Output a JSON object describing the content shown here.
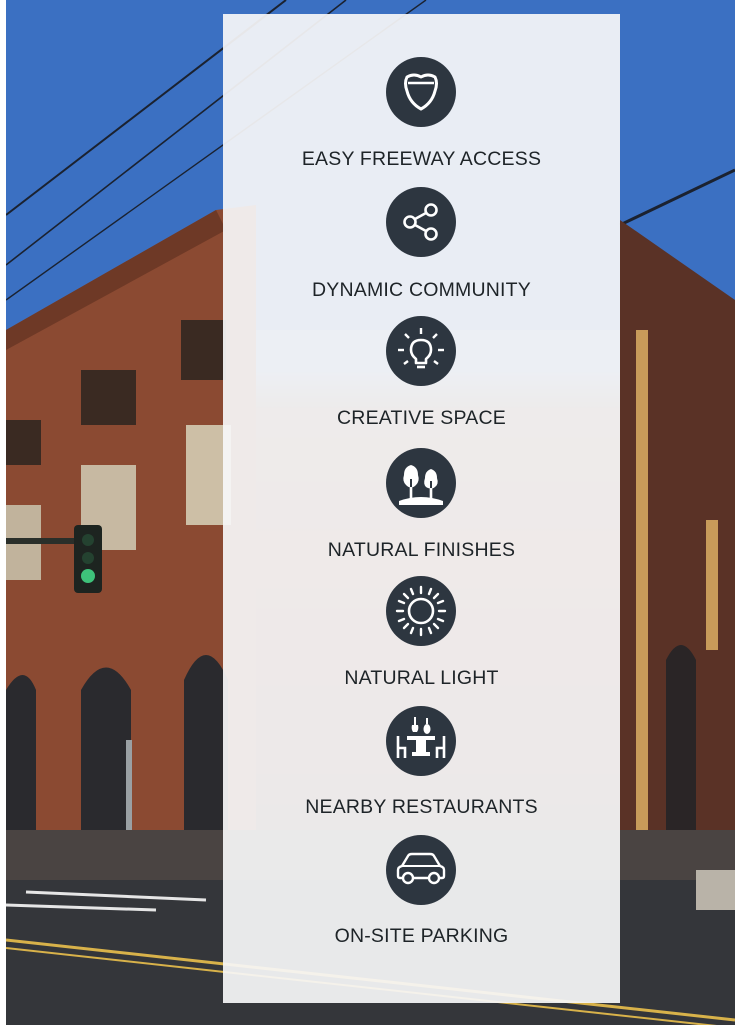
{
  "features": [
    {
      "icon": "highway-shield-icon",
      "label": "EASY FREEWAY ACCESS"
    },
    {
      "icon": "share-network-icon",
      "label": "DYNAMIC COMMUNITY"
    },
    {
      "icon": "lightbulb-icon",
      "label": "CREATIVE SPACE"
    },
    {
      "icon": "trees-icon",
      "label": "NATURAL FINISHES"
    },
    {
      "icon": "sun-icon",
      "label": "NATURAL LIGHT"
    },
    {
      "icon": "dining-table-icon",
      "label": "NEARBY RESTAURANTS"
    },
    {
      "icon": "car-icon",
      "label": "ON-SITE PARKING"
    }
  ],
  "colors": {
    "icon_circle": "#2d3640",
    "panel": "#f6f6f7",
    "label_text": "#1e2428"
  }
}
